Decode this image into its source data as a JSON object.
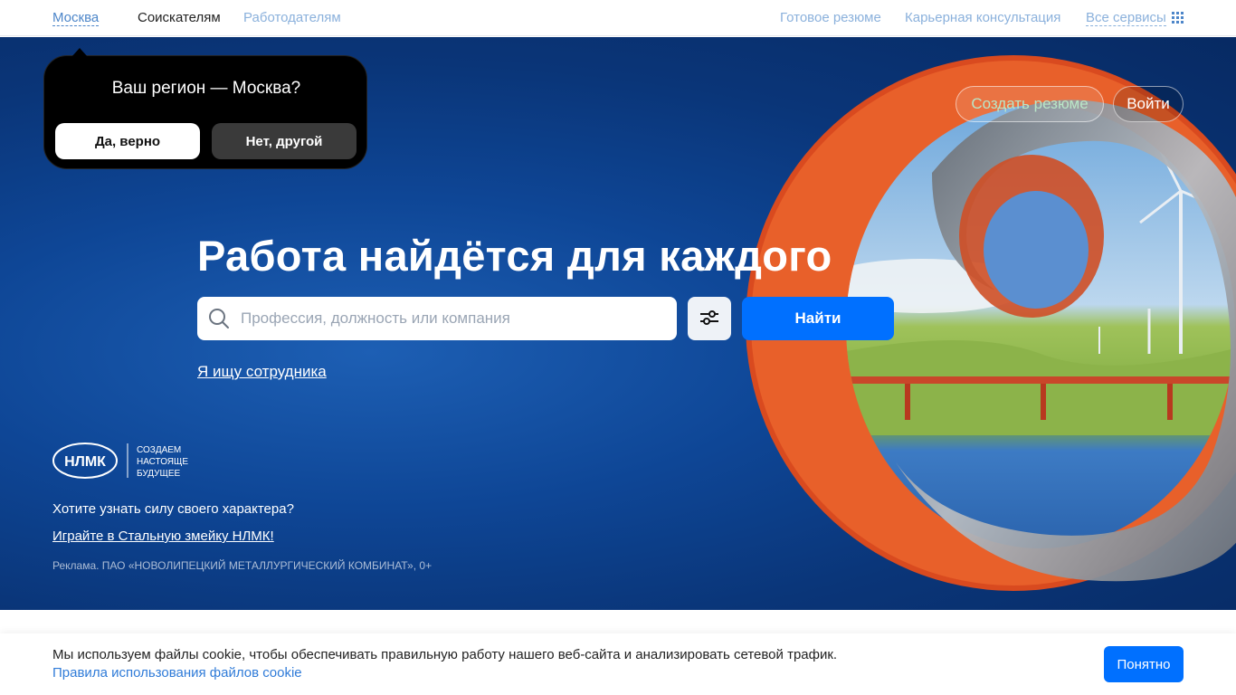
{
  "topnav": {
    "city": "Москва",
    "seekers": "Соискателям",
    "employers": "Работодателям",
    "ready_resume": "Готовое резюме",
    "career_consult": "Карьерная консультация",
    "all_services": "Все сервисы"
  },
  "region_popup": {
    "question": "Ваш регион — Москва?",
    "yes": "Да, верно",
    "no": "Нет, другой"
  },
  "hero": {
    "create_resume": "Создать резюме",
    "login": "Войти",
    "headline": "Работа найдётся для каждого",
    "search_placeholder": "Профессия, должность или компания",
    "search_value": "",
    "find": "Найти",
    "employer_link": "Я ищу сотрудника"
  },
  "ad": {
    "logo_text": "НЛМК",
    "slogan_line1": "СОЗДАЕМ",
    "slogan_line2": "НАСТОЯЩЕЕ",
    "slogan_line3": "БУДУЩЕЕ",
    "question": "Хотите узнать силу своего характера?",
    "link": "Играйте в Стальную змейку НЛМК!",
    "note": "Реклама. ПАО «НОВОЛИПЕЦКИЙ МЕТАЛЛУРГИЧЕСКИЙ КОМБИНАТ», 0+"
  },
  "cookie": {
    "text": "Мы используем файлы cookie, чтобы обеспечивать правильную работу нашего веб-сайта и анализировать сетевой трафик.",
    "link": "Правила использования файлов cookie",
    "accept": "Понятно"
  },
  "colors": {
    "accent": "#0070ff",
    "hero_bg": "#0e4696",
    "link": "#4d86c9"
  }
}
